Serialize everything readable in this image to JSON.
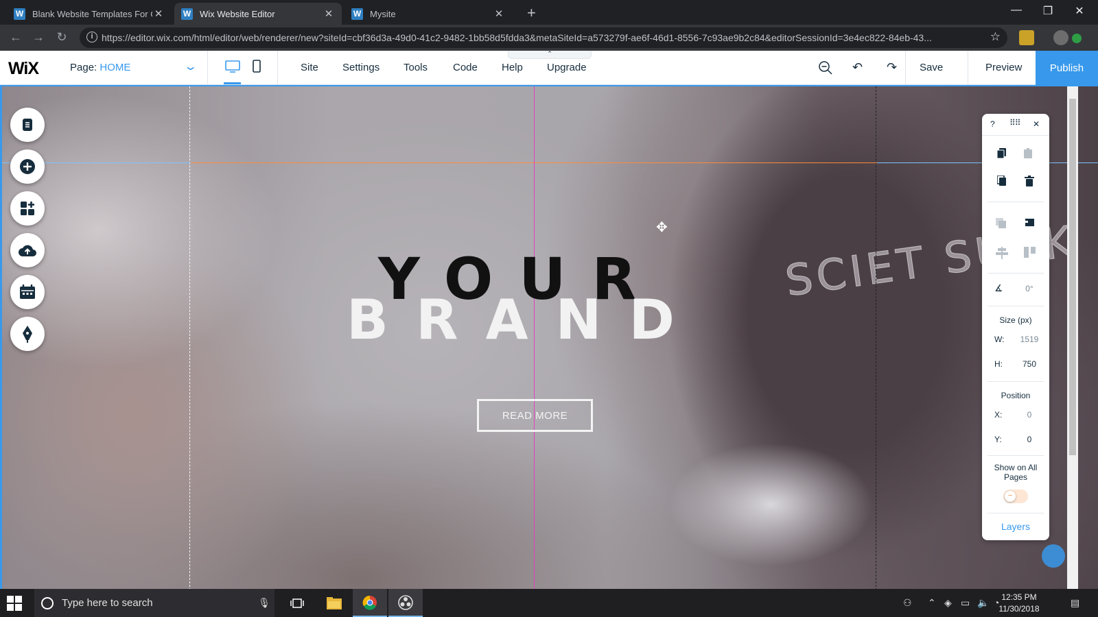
{
  "browser": {
    "tabs": [
      {
        "title": "Blank Website Templates For Cre",
        "active": false
      },
      {
        "title": "Wix Website Editor",
        "active": true
      },
      {
        "title": "Mysite",
        "active": false
      }
    ],
    "url": "https://editor.wix.com/html/editor/web/renderer/new?siteId=cbf36d3a-49d0-41c2-9482-1bb58d5fdda3&metaSiteId=a573279f-ae6f-46d1-8556-7c93ae9b2c84&editorSessionId=3e4ec822-84eb-43..."
  },
  "editor": {
    "logo": "WiX",
    "page_label": "Page:",
    "page_name": "HOME",
    "menu": [
      "Site",
      "Settings",
      "Tools",
      "Code",
      "Help",
      "Upgrade"
    ],
    "save_label": "Save",
    "preview_label": "Preview",
    "publish_label": "Publish",
    "accent_color": "#3899ec"
  },
  "canvas": {
    "headline_top": "YOUR",
    "headline_bottom": "BRAND",
    "button_label": "READ MORE",
    "shirt_text": "SCIET SUCK"
  },
  "left_tools": [
    "pages-icon",
    "add-icon",
    "app-market-icon",
    "upload-icon",
    "bookings-icon",
    "pen-icon"
  ],
  "panel": {
    "help": "?",
    "rotation": "0°",
    "size_label": "Size (px)",
    "w_label": "W:",
    "w_value": "1519",
    "h_label": "H:",
    "h_value": "750",
    "position_label": "Position",
    "x_label": "X:",
    "x_value": "0",
    "y_label": "Y:",
    "y_value": "0",
    "show_all_pages": "Show on All Pages",
    "layers_label": "Layers"
  },
  "taskbar": {
    "search_placeholder": "Type here to search",
    "time": "12:35 PM",
    "date": "11/30/2018"
  }
}
